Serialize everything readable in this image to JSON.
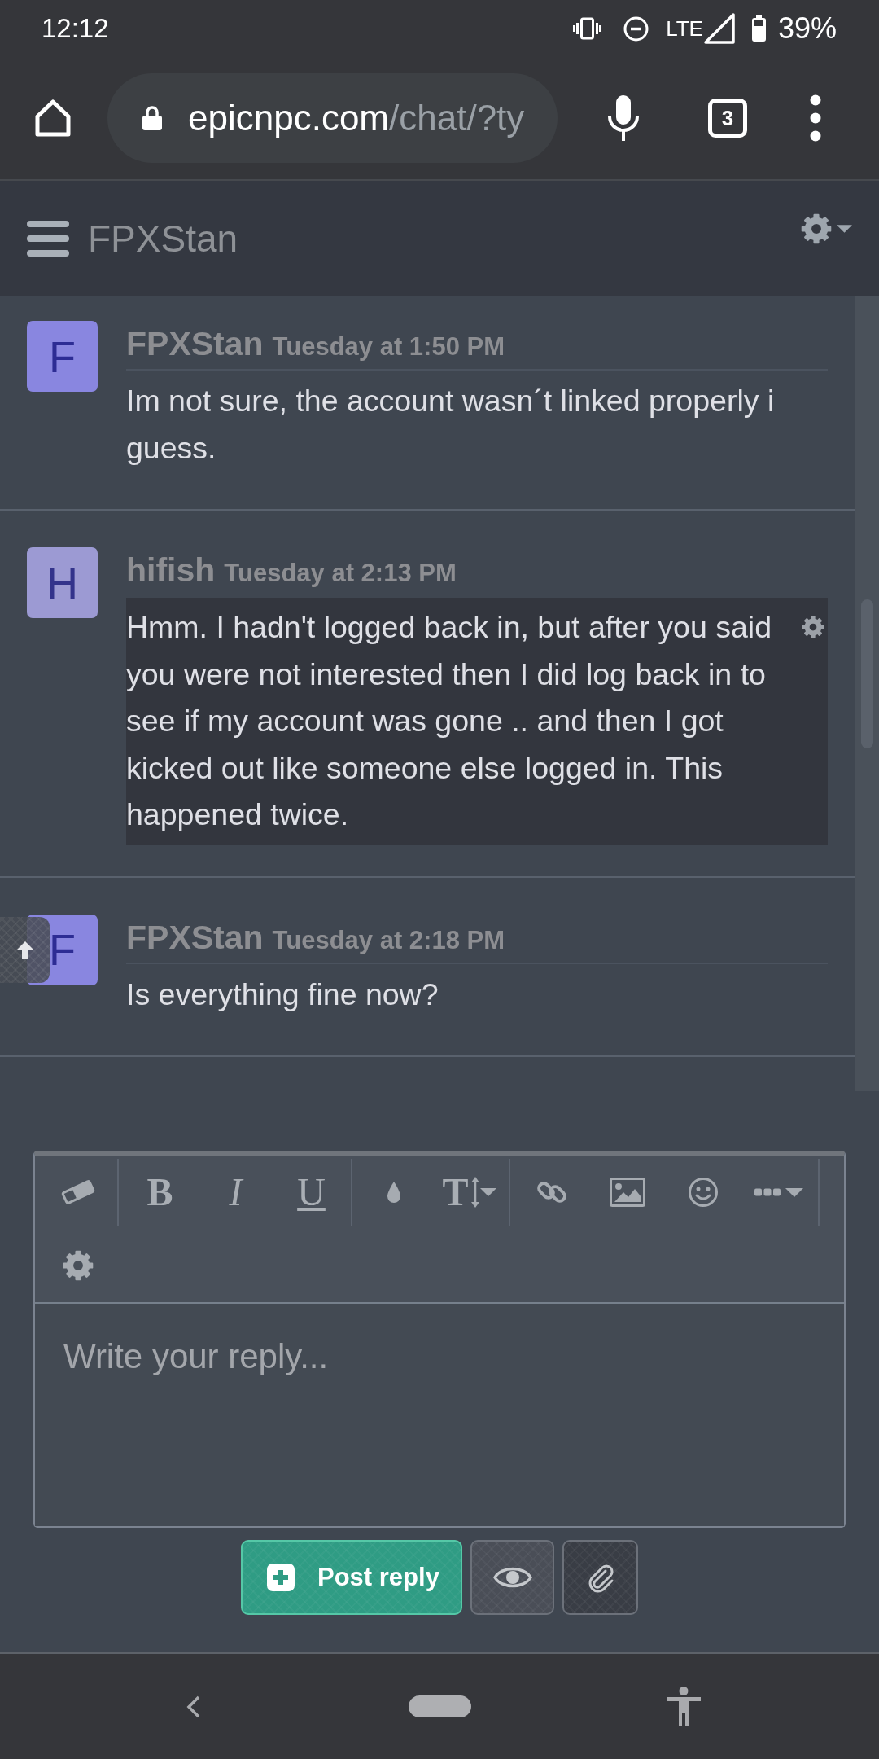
{
  "status_bar": {
    "time": "12:12",
    "network": "LTE",
    "battery": "39%"
  },
  "browser": {
    "url_host": "epicnpc.com",
    "url_path": "/chat/?ty",
    "tab_count": "3"
  },
  "header": {
    "title": "FPXStan"
  },
  "messages": [
    {
      "author": "FPXStan",
      "initial": "F",
      "color": "#8986e0",
      "time": "Tuesday at 1:50 PM",
      "text": "Im not sure, the account wasn´t linked properly i guess.",
      "highlighted": false
    },
    {
      "author": "hifish",
      "initial": "H",
      "color": "#9c9ad3",
      "time": "Tuesday at 2:13 PM",
      "text": "Hmm. I hadn't logged back in, but after you said you were not interested then I did log back in to see if my account was gone .. and then I got kicked out like someone else logged in. This happened twice.",
      "highlighted": true
    },
    {
      "author": "FPXStan",
      "initial": "F",
      "color": "#8986e0",
      "time": "Tuesday at 2:18 PM",
      "text": "Is everything fine now?",
      "highlighted": false
    }
  ],
  "editor": {
    "toolbar": [
      [
        {
          "kind": "eraser"
        }
      ],
      [
        {
          "kind": "bold",
          "glyph": "B"
        },
        {
          "kind": "italic",
          "glyph": "I"
        },
        {
          "kind": "underline",
          "glyph": "U"
        }
      ],
      [
        {
          "kind": "color"
        },
        {
          "kind": "size",
          "glyph": "T"
        }
      ],
      [
        {
          "kind": "link"
        },
        {
          "kind": "image"
        },
        {
          "kind": "emoji"
        },
        {
          "kind": "more"
        }
      ],
      [
        {
          "kind": "settings"
        }
      ]
    ],
    "placeholder": "Write your reply..."
  },
  "actions": [
    {
      "kind": "submit",
      "label": "Post reply"
    },
    {
      "kind": "preview"
    },
    {
      "kind": "attach"
    }
  ]
}
